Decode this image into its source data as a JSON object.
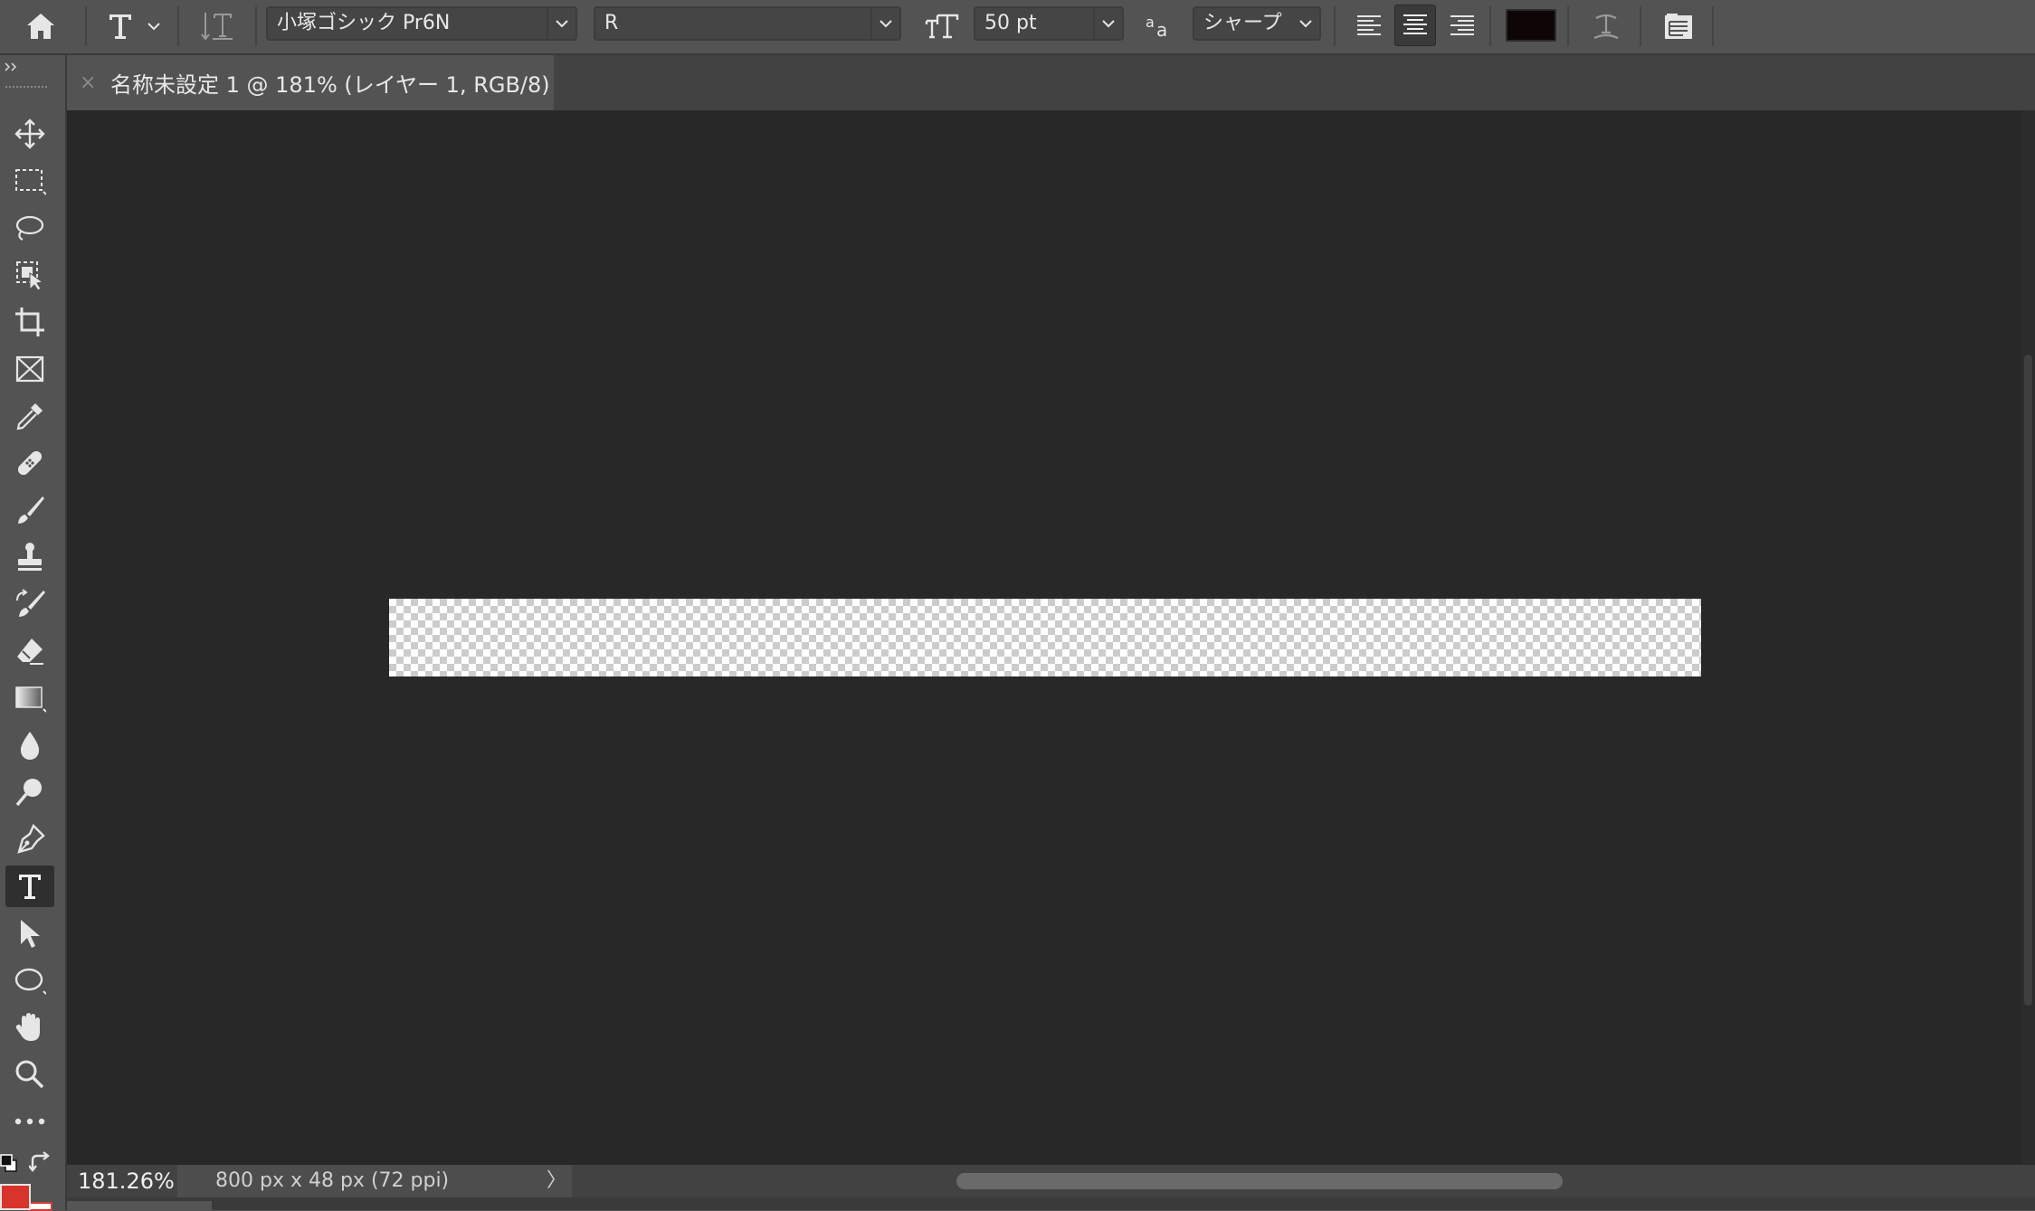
{
  "options_bar": {
    "font_family": "小塚ゴシック Pr6N",
    "font_style": "R",
    "font_size": "50 pt",
    "antialias": "シャープ",
    "text_color": "#0e0606"
  },
  "document_tab": {
    "close_glyph": "×",
    "title": "名称未設定 1 @ 181% (レイヤー 1, RGB/8)"
  },
  "tools": [
    {
      "name": "move-tool",
      "icon": "move-icon"
    },
    {
      "name": "rectangular-marquee-tool",
      "icon": "marquee-icon"
    },
    {
      "name": "lasso-tool",
      "icon": "lasso-icon"
    },
    {
      "name": "object-selection-tool",
      "icon": "object-selection-icon"
    },
    {
      "name": "crop-tool",
      "icon": "crop-icon"
    },
    {
      "name": "frame-tool",
      "icon": "frame-icon"
    },
    {
      "name": "eyedropper-tool",
      "icon": "eyedropper-icon"
    },
    {
      "name": "healing-brush-tool",
      "icon": "bandage-icon"
    },
    {
      "name": "brush-tool",
      "icon": "brush-icon"
    },
    {
      "name": "clone-stamp-tool",
      "icon": "stamp-icon"
    },
    {
      "name": "history-brush-tool",
      "icon": "history-brush-icon"
    },
    {
      "name": "eraser-tool",
      "icon": "eraser-icon"
    },
    {
      "name": "gradient-tool",
      "icon": "gradient-icon"
    },
    {
      "name": "blur-tool",
      "icon": "drop-icon"
    },
    {
      "name": "dodge-tool",
      "icon": "dodge-icon"
    },
    {
      "name": "pen-tool",
      "icon": "pen-icon"
    },
    {
      "name": "type-tool",
      "icon": "type-icon",
      "active": true
    },
    {
      "name": "path-selection-tool",
      "icon": "arrow-cursor-icon"
    },
    {
      "name": "ellipse-tool",
      "icon": "ellipse-icon"
    },
    {
      "name": "hand-tool",
      "icon": "hand-icon"
    },
    {
      "name": "zoom-tool",
      "icon": "magnifier-icon"
    },
    {
      "name": "more-tools",
      "icon": "more-icon"
    }
  ],
  "colors": {
    "foreground": "#d9342b",
    "background": "#ffffff"
  },
  "status": {
    "zoom": "181.26%",
    "doc_info": "800 px x 48 px (72 ppi)",
    "chevron": "〉"
  }
}
